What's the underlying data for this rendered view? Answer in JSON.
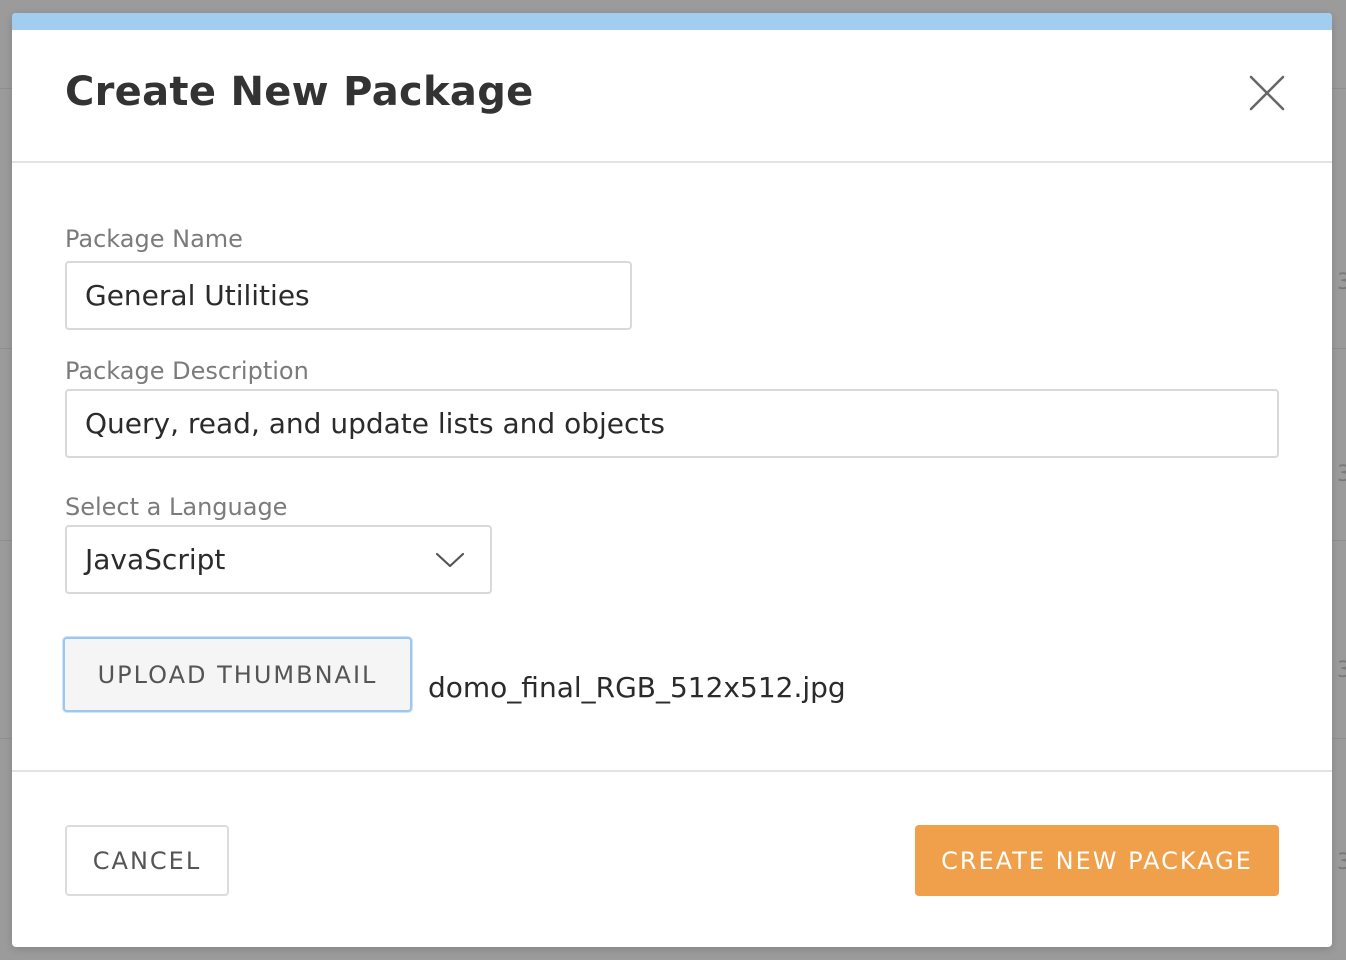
{
  "dialog": {
    "title": "Create New Package",
    "accent_color": "#a3cdf0"
  },
  "form": {
    "package_name": {
      "label": "Package Name",
      "value": "General Utilities"
    },
    "package_description": {
      "label": "Package Description",
      "value": "Query, read, and update lists and objects"
    },
    "language": {
      "label": "Select a Language",
      "selected": "JavaScript"
    },
    "thumbnail": {
      "button_label": "UPLOAD THUMBNAIL",
      "file_name": "domo_final_RGB_512x512.jpg"
    }
  },
  "footer": {
    "cancel_label": "CANCEL",
    "submit_label": "CREATE NEW PACKAGE",
    "submit_color": "#f0a04a"
  },
  "icons": {
    "close": "close-icon",
    "dropdown": "chevron-down-icon"
  }
}
